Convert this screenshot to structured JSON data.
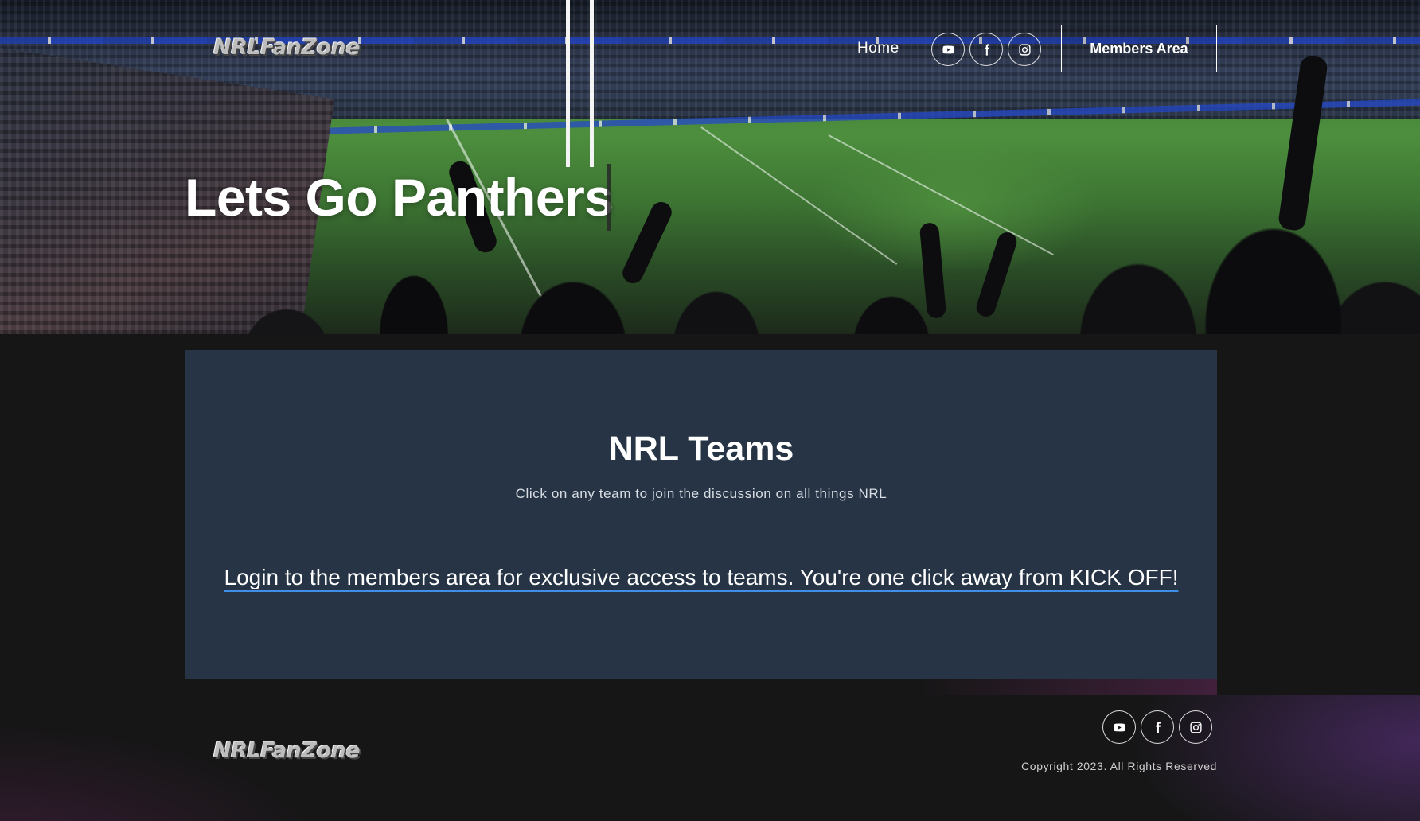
{
  "nav": {
    "logo": "NRLFanZone",
    "home": "Home",
    "members_area": "Members Area",
    "social_icons": [
      "youtube-icon",
      "facebook-icon",
      "instagram-icon"
    ]
  },
  "hero": {
    "title": "Lets Go Panthers"
  },
  "main": {
    "title": "NRL Teams",
    "subtitle": "Click on any team to join the discussion on all things NRL",
    "login_link": "Login to the members area for exclusive access to teams. You're one click away from KICK OFF!"
  },
  "footer": {
    "logo": "NRLFanZone",
    "copyright": "Copyright 2023. All Rights Reserved",
    "social_icons": [
      "youtube-icon",
      "facebook-icon",
      "instagram-icon"
    ]
  },
  "colors": {
    "panel_bg": "#263445",
    "page_bg": "#161616",
    "link_underline": "#3f8fe8"
  }
}
